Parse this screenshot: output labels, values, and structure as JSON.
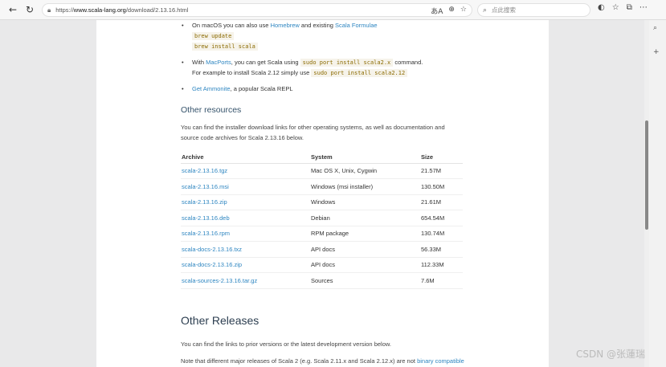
{
  "browser": {
    "url_prefix": "https://",
    "url_domain": "www.scala-lang.org",
    "url_path": "/download/2.13.16.html",
    "search_placeholder": "点此搜索",
    "translate_label": "あA"
  },
  "bullets": [
    {
      "pre": "On macOS you can also use ",
      "link1": "Homebrew",
      "mid": " and existing ",
      "link2": "Scala Formulae",
      "code1": "brew update",
      "code2": "brew install scala"
    },
    {
      "pre": "With ",
      "link1": "MacPorts",
      "mid": ", you can get Scala using ",
      "code1": "sudo port install scala2.x",
      "post": " command.",
      "line2": "For example to install Scala 2.12 simply use ",
      "code2": "sudo port install scala2.12"
    },
    {
      "link1": "Get Ammonite",
      "post": ", a popular Scala REPL"
    }
  ],
  "other_resources": {
    "heading": "Other resources",
    "text_line1": "You can find the installer download links for other operating systems, as well as documentation and",
    "text_line2": "source code archives for Scala 2.13.16 below."
  },
  "table": {
    "headers": [
      "Archive",
      "System",
      "Size"
    ],
    "rows": [
      [
        "scala-2.13.16.tgz",
        "Mac OS X, Unix, Cygwin",
        "21.57M"
      ],
      [
        "scala-2.13.16.msi",
        "Windows (msi installer)",
        "130.50M"
      ],
      [
        "scala-2.13.16.zip",
        "Windows",
        "21.61M"
      ],
      [
        "scala-2.13.16.deb",
        "Debian",
        "654.54M"
      ],
      [
        "scala-2.13.16.rpm",
        "RPM package",
        "130.74M"
      ],
      [
        "scala-docs-2.13.16.txz",
        "API docs",
        "56.33M"
      ],
      [
        "scala-docs-2.13.16.zip",
        "API docs",
        "112.33M"
      ],
      [
        "scala-sources-2.13.16.tar.gz",
        "Sources",
        "7.6M"
      ]
    ]
  },
  "other_releases": {
    "heading": "Other Releases",
    "text1": "You can find the links to prior versions or the latest development version below.",
    "text2_pre": "Note that different major releases of Scala 2 (e.g. Scala 2.11.x and Scala 2.12.x) are not ",
    "text2_link": "binary compatible"
  },
  "watermark": "CSDN @张蓮瑞",
  "colors": {
    "link": "#2e86c1",
    "heading": "#35536b",
    "code": "#8b6a00"
  }
}
